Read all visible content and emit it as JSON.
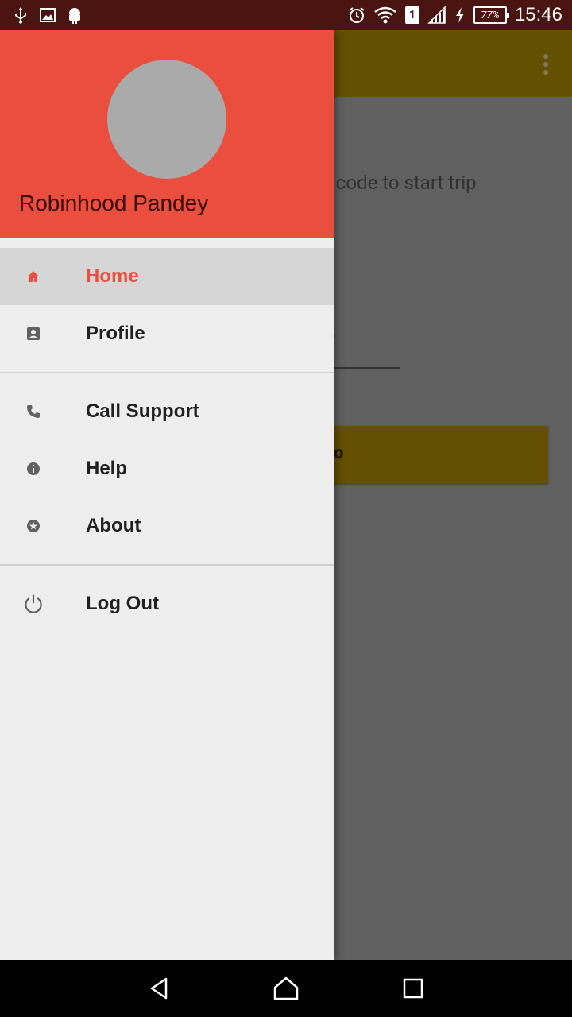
{
  "status_bar": {
    "time": "15:46",
    "battery": "77%",
    "sim": "1",
    "left_icons": [
      "usb-icon",
      "image-icon",
      "android-icon"
    ],
    "right_icons": [
      "alarm-icon",
      "wifi-icon",
      "sim-icon",
      "signal-icon",
      "charging-icon",
      "battery-icon"
    ]
  },
  "background": {
    "hint_text": "to start trip",
    "field_fragment": "o",
    "button_fragment": "o"
  },
  "drawer": {
    "user_name": "Robinhood Pandey",
    "items": [
      {
        "label": "Home",
        "icon": "home-icon",
        "active": true
      },
      {
        "label": "Profile",
        "icon": "profile-icon",
        "active": false
      }
    ],
    "support_items": [
      {
        "label": "Call Support",
        "icon": "phone-icon"
      },
      {
        "label": "Help",
        "icon": "info-icon"
      },
      {
        "label": "About",
        "icon": "star-icon"
      }
    ],
    "logout": {
      "label": "Log Out",
      "icon": "power-icon"
    }
  },
  "colors": {
    "accent": "#e94e3e",
    "appbar_dimmed": "#645000"
  }
}
